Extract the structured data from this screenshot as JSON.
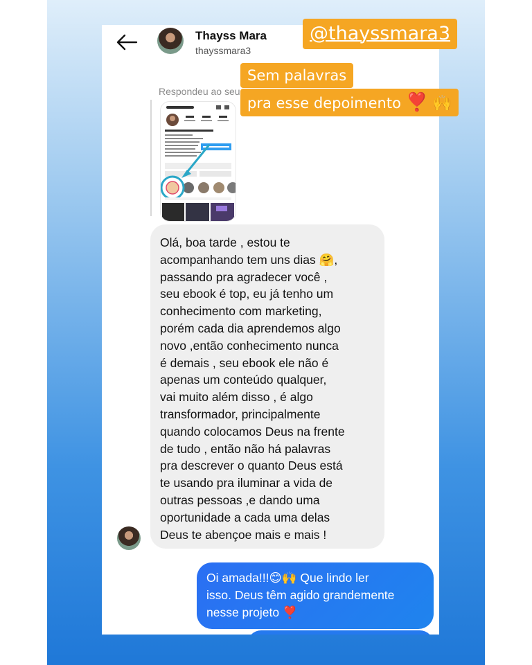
{
  "header": {
    "name": "Thayss Mara",
    "username": "thayssmara3"
  },
  "reply": {
    "label": "Respondeu ao seu"
  },
  "messages": {
    "incoming": "Olá, boa tarde , estou te\nacompanhando tem uns dias 🤗,\npassando pra agradecer você ,\nseu ebook é top, eu já tenho um\nconhecimento com marketing,\nporém cada dia aprendemos algo\nnovo ,então conhecimento nunca\né demais , seu ebook ele não é\napenas um conteúdo qualquer,\nvai muito além disso , é algo\ntransformador, principalmente\nquando colocamos Deus na frente\nde tudo , então não há palavras\npra descrever o quanto Deus está\nte usando pra iluminar a vida de\noutras pessoas ,e dando uma\noportunidade a cada uma delas\nDeus te abençoe mais e mais !",
    "outgoing": "Oi amada!!!😊🙌 Que lindo ler\nisso. Deus têm agido grandemente\nnesse projeto ❣️"
  },
  "stickers": {
    "handle": "@thayssmara3",
    "line1": "Sem palavras",
    "line2": "pra esse depoimento",
    "heart": "❣️",
    "hands": "🙌"
  },
  "colors": {
    "sticker": "#f5a623",
    "outgoing_bubble": "#2b6ff3",
    "incoming_bubble": "#efefef"
  }
}
